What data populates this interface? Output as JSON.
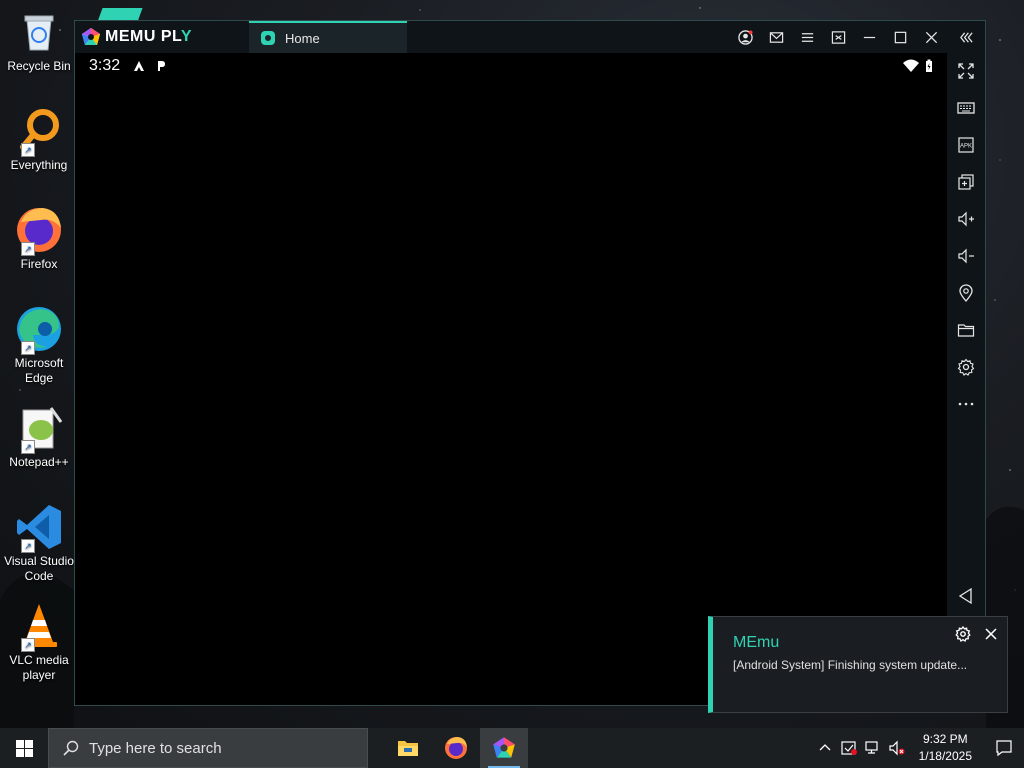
{
  "desktop": {
    "icons": [
      {
        "label": "Recycle Bin",
        "icon": "recycle-bin-icon"
      },
      {
        "label": "Everything",
        "icon": "everything-search-icon"
      },
      {
        "label": "Firefox",
        "icon": "firefox-icon"
      },
      {
        "label": "Microsoft Edge",
        "icon": "edge-icon"
      },
      {
        "label": "Notepad++",
        "icon": "notepadpp-icon"
      },
      {
        "label": "Visual Studio Code",
        "icon": "vscode-icon"
      },
      {
        "label": "VLC media player",
        "icon": "vlc-icon"
      }
    ]
  },
  "memu": {
    "brand": "MEMU PL",
    "brand_tail": "Y",
    "tab_label": "Home",
    "accent_color": "#2fd3b4",
    "title_buttons": [
      "account-icon",
      "mail-icon",
      "menu-icon",
      "screen-mode-icon",
      "minimize-icon",
      "maximize-icon",
      "close-icon",
      "collapse-sidebar-icon"
    ],
    "android_status": {
      "time": "3:32"
    },
    "side_toolbar": [
      "fullscreen-icon",
      "keyboard-icon",
      "apk-install-icon",
      "multi-instance-icon",
      "volume-up-icon",
      "volume-down-icon",
      "location-icon",
      "shared-folder-icon",
      "settings-icon",
      "more-icon",
      "back-icon"
    ]
  },
  "toast": {
    "title": "MEmu",
    "body": "[Android System] Finishing system update..."
  },
  "taskbar": {
    "search_placeholder": "Type here to search",
    "apps": [
      "file-explorer-icon",
      "firefox-icon",
      "memu-icon"
    ],
    "time": "9:32 PM",
    "date": "1/18/2025"
  }
}
